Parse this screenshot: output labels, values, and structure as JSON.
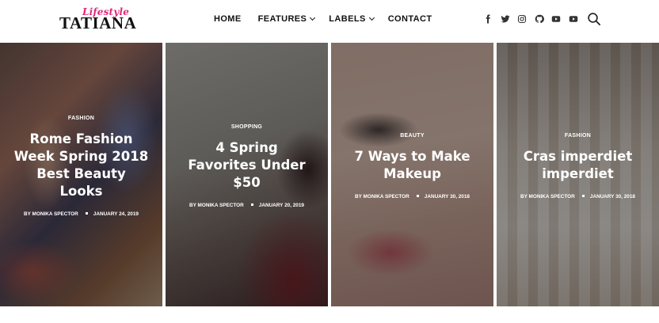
{
  "brand": {
    "script": "Lifestyle",
    "name": "TATIANA",
    "script_color": "#e0287a"
  },
  "nav": {
    "home": "HOME",
    "features": "FEATURES",
    "labels": "LABELS",
    "contact": "CONTACT"
  },
  "socials": [
    "facebook-icon",
    "twitter-icon",
    "instagram-icon",
    "github-icon",
    "youtube-icon",
    "youtube-icon"
  ],
  "cards": [
    {
      "category": "FASHION",
      "title": "Rome Fashion Week Spring 2018 Best Beauty Looks",
      "author": "BY MONIKA SPECTOR",
      "date": "JANUARY 24, 2019"
    },
    {
      "category": "SHOPPING",
      "title": "4 Spring Favorites Under $50",
      "author": "BY MONIKA SPECTOR",
      "date": "JANUARY 20, 2019"
    },
    {
      "category": "BEAUTY",
      "title": "7 Ways to Make Makeup",
      "author": "BY MONIKA SPECTOR",
      "date": "JANUARY 30, 2018"
    },
    {
      "category": "FASHION",
      "title": "Cras imperdiet imperdiet",
      "author": "BY MONIKA SPECTOR",
      "date": "JANUARY 30, 2018"
    }
  ]
}
